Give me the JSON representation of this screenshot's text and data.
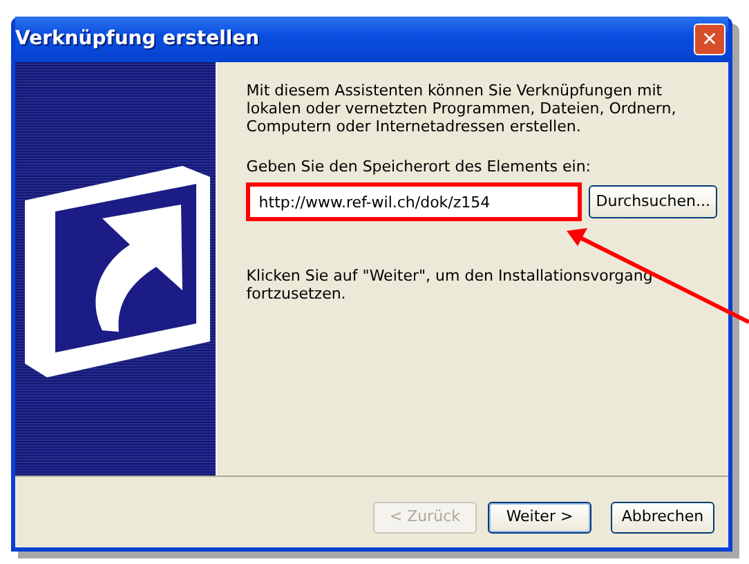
{
  "window": {
    "title": "Verknüpfung erstellen",
    "close_label": "✕"
  },
  "intro": "Mit diesem Assistenten können Sie Verknüpfungen mit lokalen oder vernetzten Programmen, Dateien, Ordnern, Computern oder Internetadressen erstellen.",
  "location": {
    "label": "Geben Sie den Speicherort des Elements ein:",
    "value": "http://www.ref-wil.ch/dok/z154",
    "highlighted": true,
    "browse_button": "Durchsuchen..."
  },
  "hint": "Klicken Sie auf \"Weiter\", um den Installationsvorgang fortzusetzen.",
  "buttons": [
    {
      "label": "< Zurück",
      "disabled": true,
      "default": false
    },
    {
      "label": "Weiter >",
      "disabled": false,
      "default": true
    },
    {
      "label": "Abbrechen",
      "disabled": false,
      "default": false
    }
  ]
}
